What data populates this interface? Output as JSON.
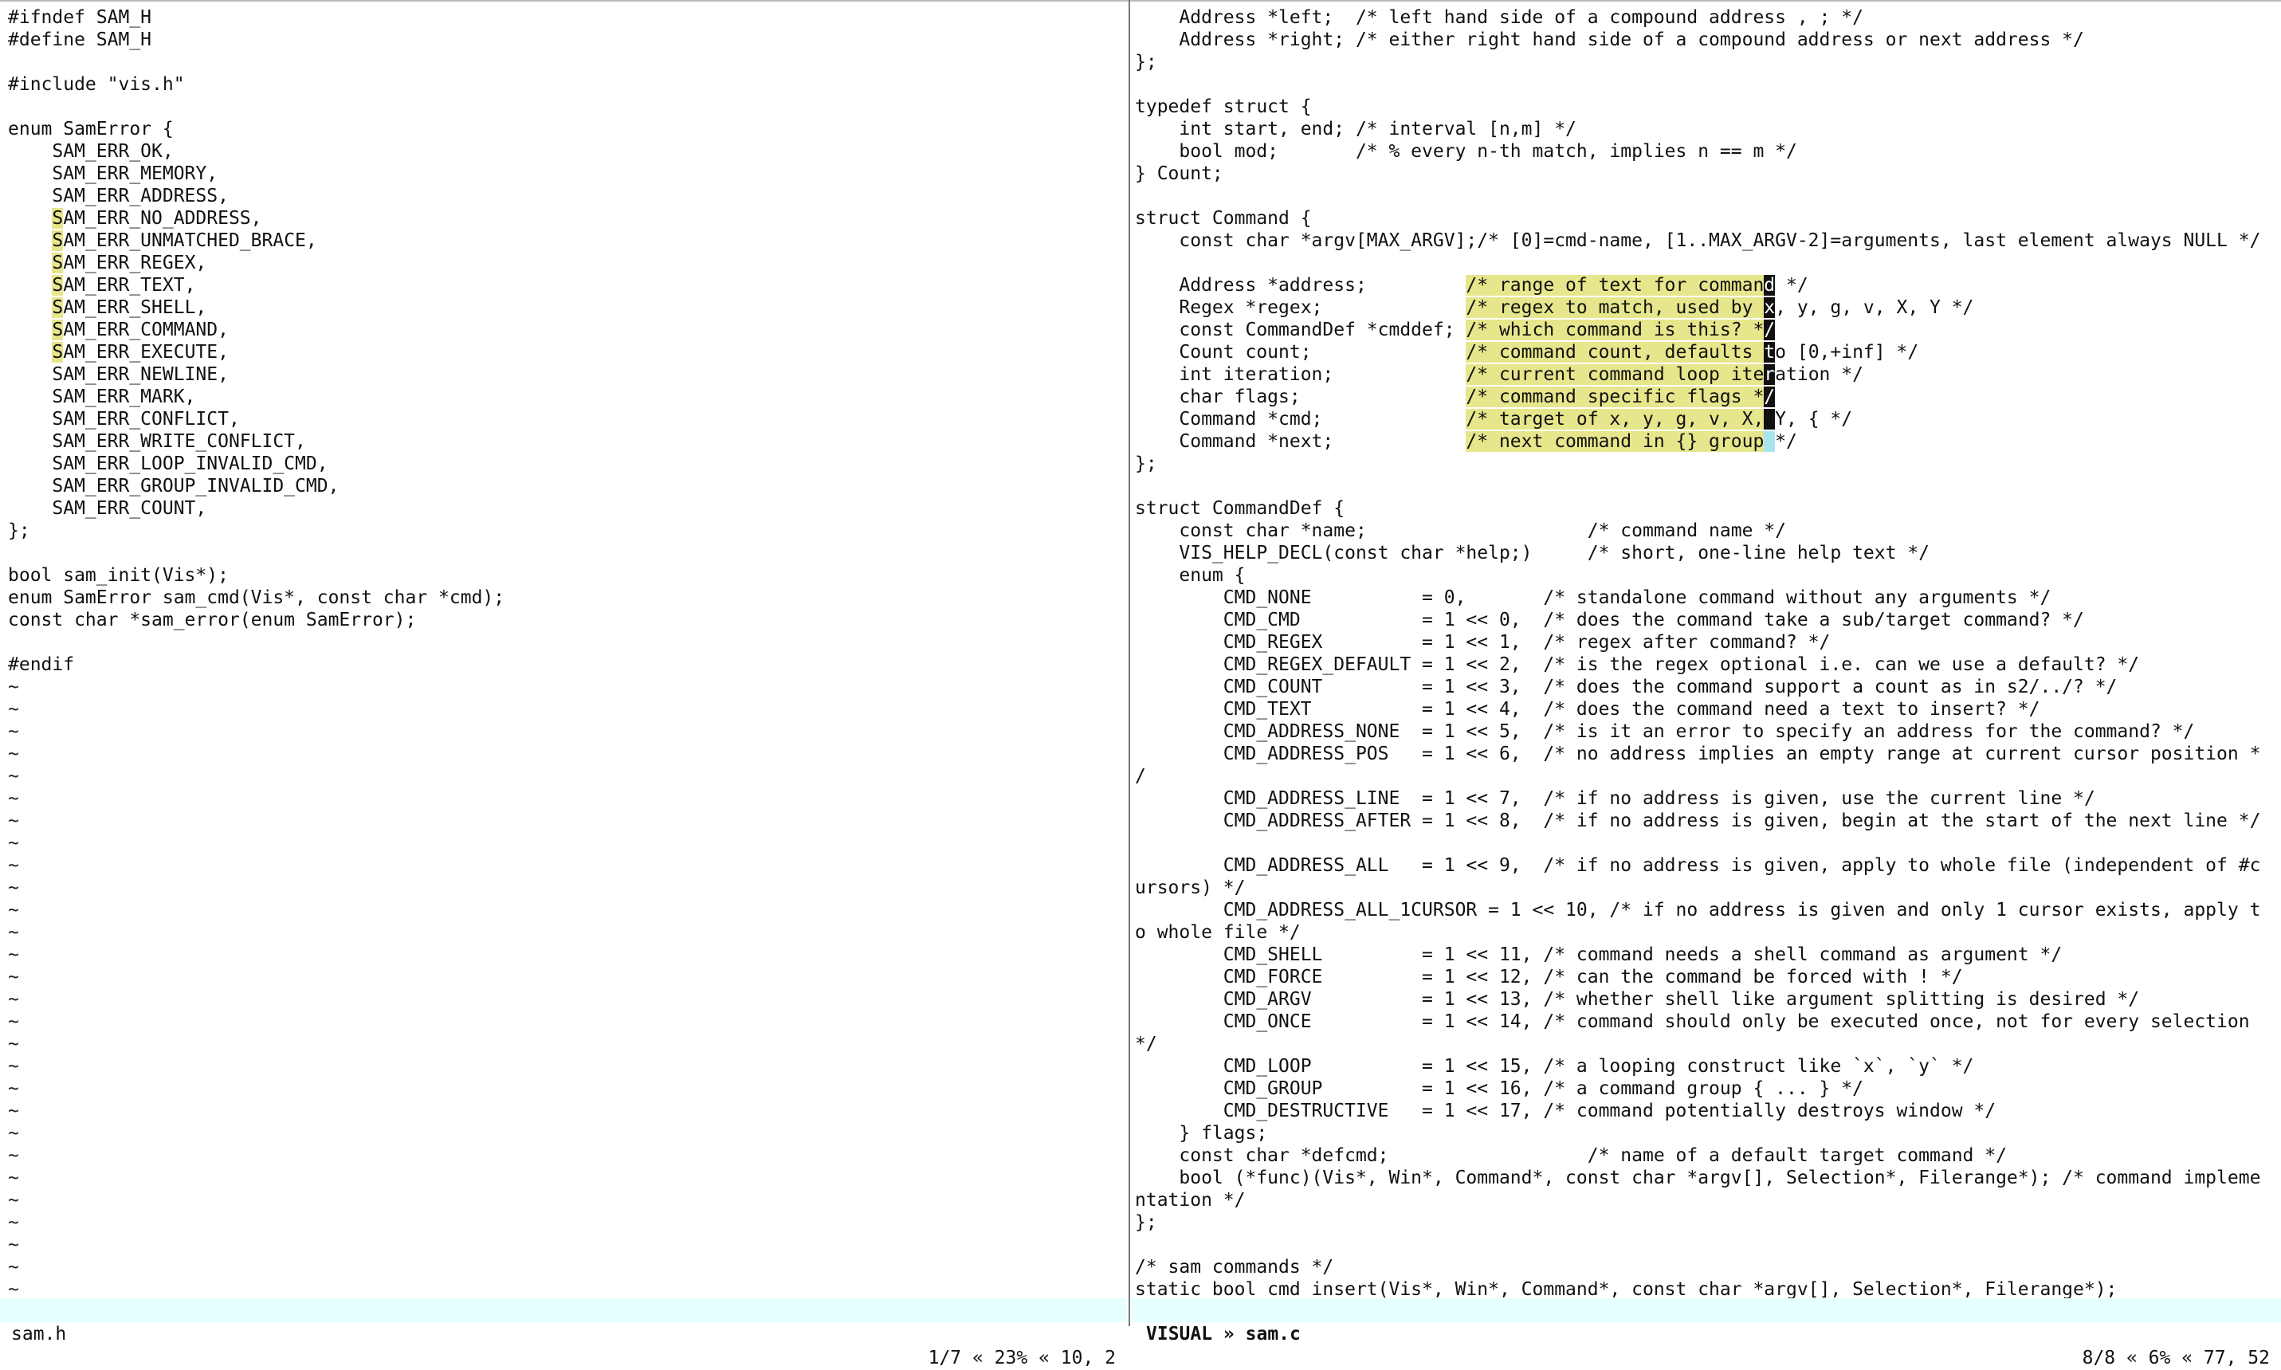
{
  "colors": {
    "background": "#ffffff",
    "text": "#111111",
    "selection": "#e6e68c",
    "cursor": "#111111",
    "primary_cursor": "#a8e4ee",
    "statusbar": "#e6ffff"
  },
  "left": {
    "lines": [
      "#ifndef SAM_H",
      "#define SAM_H",
      "",
      "#include \"vis.h\"",
      "",
      "enum SamError {",
      "    SAM_ERR_OK,",
      "    SAM_ERR_MEMORY,",
      "    SAM_ERR_ADDRESS,",
      "    SAM_ERR_NO_ADDRESS,",
      "    SAM_ERR_UNMATCHED_BRACE,",
      "    SAM_ERR_REGEX,",
      "    SAM_ERR_TEXT,",
      "    SAM_ERR_SHELL,",
      "    SAM_ERR_COMMAND,",
      "    SAM_ERR_EXECUTE,",
      "    SAM_ERR_NEWLINE,",
      "    SAM_ERR_MARK,",
      "    SAM_ERR_CONFLICT,",
      "    SAM_ERR_WRITE_CONFLICT,",
      "    SAM_ERR_LOOP_INVALID_CMD,",
      "    SAM_ERR_GROUP_INVALID_CMD,",
      "    SAM_ERR_COUNT,",
      "};",
      "",
      "bool sam_init(Vis*);",
      "enum SamError sam_cmd(Vis*, const char *cmd);",
      "const char *sam_error(enum SamError);",
      "",
      "#endif"
    ],
    "tilde": "~",
    "tilde_count": 28,
    "status": {
      "file": "sam.h",
      "position": "1/7 « 23% « 10, 2"
    }
  },
  "right": {
    "lines": [
      "    Address *left;  /* left hand side of a compound address , ; */",
      "    Address *right; /* either right hand side of a compound address or next address */",
      "};",
      "",
      "typedef struct {",
      "    int start, end; /* interval [n,m] */",
      "    bool mod;       /* % every n-th match, implies n == m */",
      "} Count;",
      "",
      "struct Command {",
      "    const char *argv[MAX_ARGV];/* [0]=cmd-name, [1..MAX_ARGV-2]=arguments, last element always NULL */",
      "",
      "    Address *address;         /* range of text for command */",
      "    Regex *regex;             /* regex to match, used by x, y, g, v, X, Y */",
      "    const CommandDef *cmddef; /* which command is this? */",
      "    Count count;              /* command count, defaults to [0,+inf] */",
      "    int iteration;            /* current command loop iteration */",
      "    char flags;               /* command specific flags */",
      "    Command *cmd;             /* target of x, y, g, v, X, Y, { */",
      "    Command *next;            /* next command in {} group */",
      "};",
      "",
      "struct CommandDef {",
      "    const char *name;                    /* command name */",
      "    VIS_HELP_DECL(const char *help;)     /* short, one-line help text */",
      "    enum {",
      "        CMD_NONE          = 0,       /* standalone command without any arguments */",
      "        CMD_CMD           = 1 << 0,  /* does the command take a sub/target command? */",
      "        CMD_REGEX         = 1 << 1,  /* regex after command? */",
      "        CMD_REGEX_DEFAULT = 1 << 2,  /* is the regex optional i.e. can we use a default? */",
      "        CMD_COUNT         = 1 << 3,  /* does the command support a count as in s2/../? */",
      "        CMD_TEXT          = 1 << 4,  /* does the command need a text to insert? */",
      "        CMD_ADDRESS_NONE  = 1 << 5,  /* is it an error to specify an address for the command? */",
      "        CMD_ADDRESS_POS   = 1 << 6,  /* no address implies an empty range at current cursor position *",
      "/",
      "        CMD_ADDRESS_LINE  = 1 << 7,  /* if no address is given, use the current line */",
      "        CMD_ADDRESS_AFTER = 1 << 8,  /* if no address is given, begin at the start of the next line */",
      "",
      "        CMD_ADDRESS_ALL   = 1 << 9,  /* if no address is given, apply to whole file (independent of #c",
      "ursors) */",
      "        CMD_ADDRESS_ALL_1CURSOR = 1 << 10, /* if no address is given and only 1 cursor exists, apply t",
      "o whole file */",
      "        CMD_SHELL         = 1 << 11, /* command needs a shell command as argument */",
      "        CMD_FORCE         = 1 << 12, /* can the command be forced with ! */",
      "        CMD_ARGV          = 1 << 13, /* whether shell like argument splitting is desired */",
      "        CMD_ONCE          = 1 << 14, /* command should only be executed once, not for every selection",
      "*/",
      "        CMD_LOOP          = 1 << 15, /* a looping construct like `x`, `y` */",
      "        CMD_GROUP         = 1 << 16, /* a command group { ... } */",
      "        CMD_DESTRUCTIVE   = 1 << 17, /* command potentially destroys window */",
      "    } flags;",
      "    const char *defcmd;                  /* name of a default target command */",
      "    bool (*func)(Vis*, Win*, Command*, const char *argv[], Selection*, Filerange*); /* command impleme",
      "ntation */",
      "};",
      "",
      "/* sam commands */",
      "static bool cmd_insert(Vis*, Win*, Command*, const char *argv[], Selection*, Filerange*);"
    ],
    "status": {
      "mode_file": "VISUAL » sam.c",
      "position": "8/8 « 6% « 77, 52"
    }
  }
}
